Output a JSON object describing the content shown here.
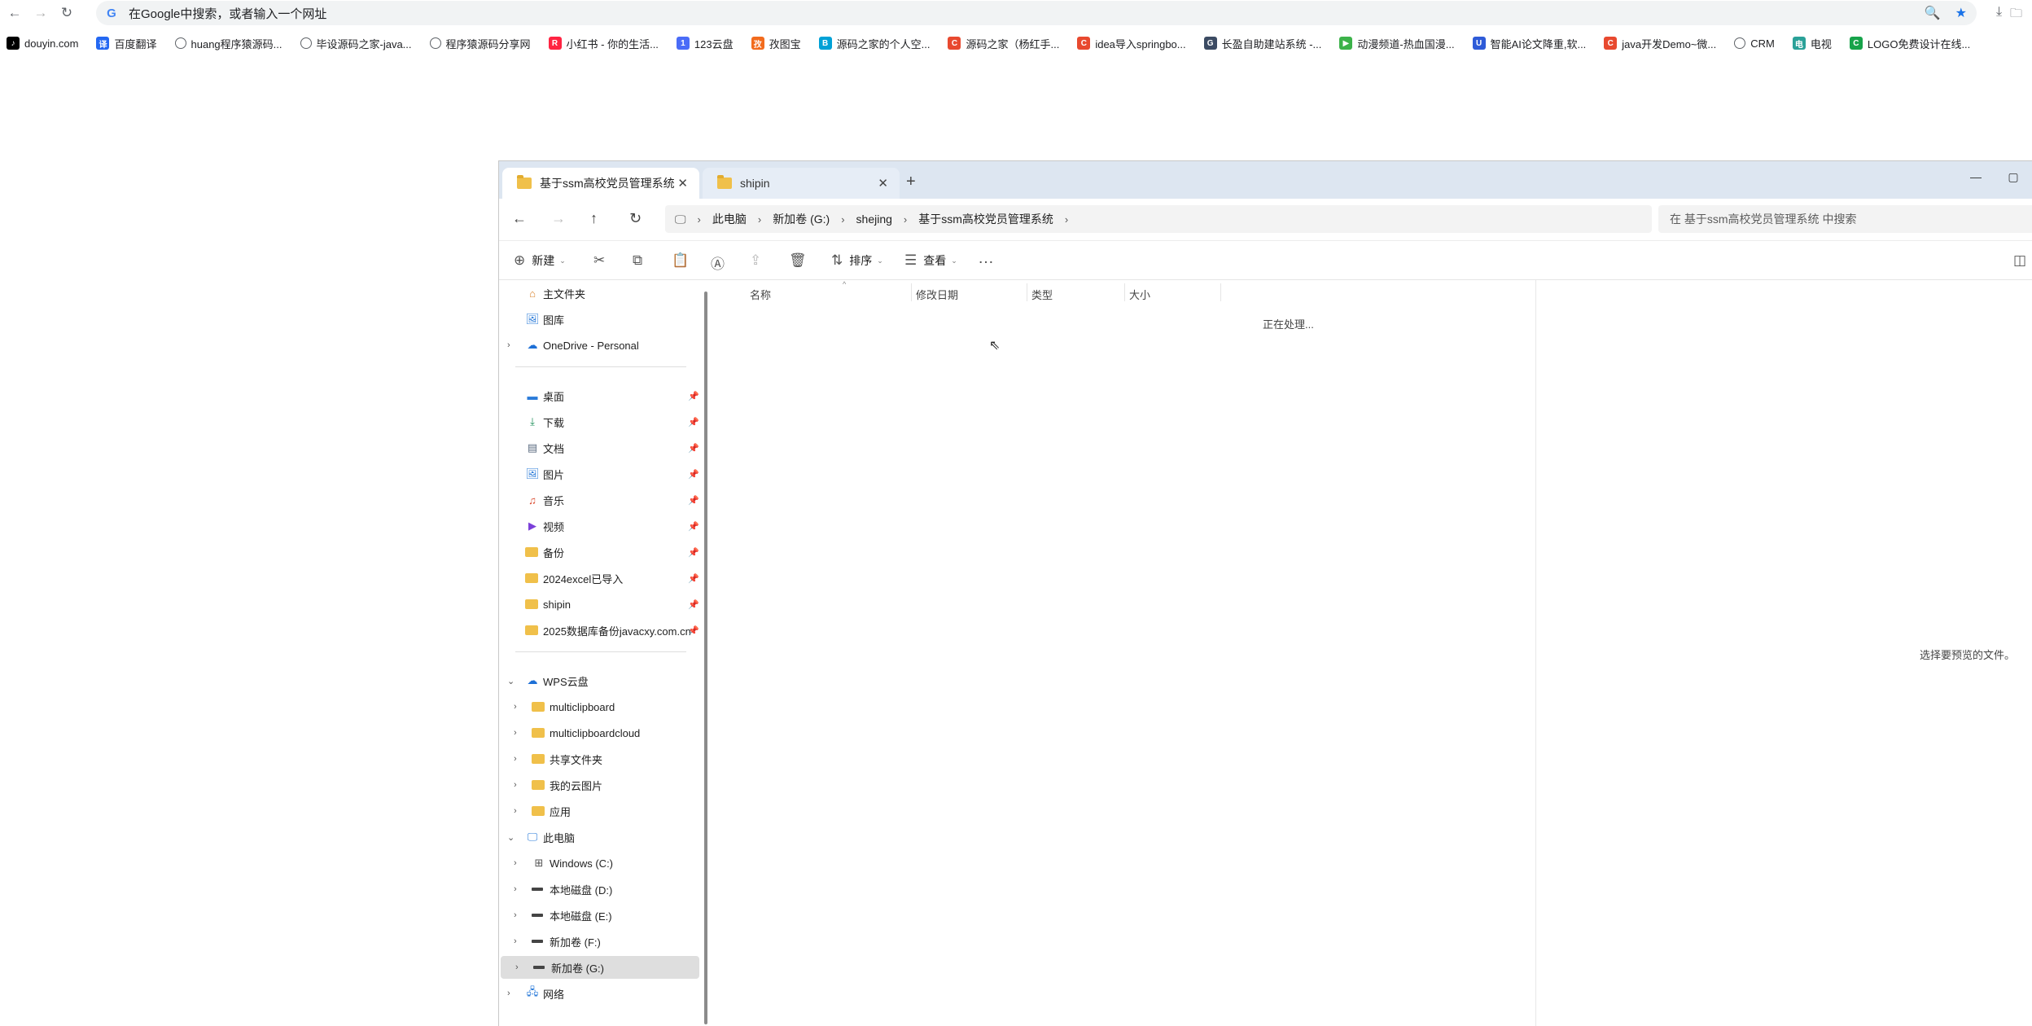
{
  "browser": {
    "omnibox_text": "在Google中搜索，或者输入一个网址"
  },
  "bookmarks": [
    {
      "label": "douyin.com",
      "color": "#000000",
      "glyph": "♪"
    },
    {
      "label": "百度翻译",
      "color": "#2468f2",
      "glyph": "译"
    },
    {
      "label": "huang程序猿源码...",
      "color": "",
      "glyph": ""
    },
    {
      "label": "毕设源码之家-java...",
      "color": "",
      "glyph": ""
    },
    {
      "label": "程序猿源码分享网",
      "color": "",
      "glyph": ""
    },
    {
      "label": "小红书 - 你的生活...",
      "color": "#ff2442",
      "glyph": "R"
    },
    {
      "label": "123云盘",
      "color": "#4a6cf7",
      "glyph": "1"
    },
    {
      "label": "孜图宝",
      "color": "#f26b1d",
      "glyph": "孜"
    },
    {
      "label": "源码之家的个人空...",
      "color": "#00a1d6",
      "glyph": "B"
    },
    {
      "label": "源码之家（杨红手...",
      "color": "#e8492f",
      "glyph": "C"
    },
    {
      "label": "idea导入springbo...",
      "color": "#e8492f",
      "glyph": "C"
    },
    {
      "label": "长盈自助建站系统 -...",
      "color": "#3c4b63",
      "glyph": "G"
    },
    {
      "label": "动漫频道-热血国漫...",
      "color": "#3cb24a",
      "glyph": "▶"
    },
    {
      "label": "智能AI论文降重,软...",
      "color": "#2e5bd8",
      "glyph": "U"
    },
    {
      "label": "java开发Demo~微...",
      "color": "#e8492f",
      "glyph": "C"
    },
    {
      "label": "CRM",
      "color": "",
      "glyph": ""
    },
    {
      "label": "电视",
      "color": "#2aa198",
      "glyph": "电"
    },
    {
      "label": "LOGO免费设计在线...",
      "color": "#17a34a",
      "glyph": "C"
    }
  ],
  "explorer": {
    "tabs": [
      {
        "label": "基于ssm高校党员管理系统"
      },
      {
        "label": "shipin"
      }
    ],
    "breadcrumb": [
      "此电脑",
      "新加卷 (G:)",
      "shejing",
      "基于ssm高校党员管理系统"
    ],
    "search_placeholder": "在 基于ssm高校党员管理系统 中搜索",
    "commands": {
      "new": "新建",
      "sort": "排序",
      "view": "查看"
    },
    "nav": {
      "home": "主文件夹",
      "gallery": "图库",
      "onedrive": "OneDrive - Personal",
      "quick": [
        {
          "label": "桌面",
          "icon": "desktop-icon"
        },
        {
          "label": "下载",
          "icon": "download-icon"
        },
        {
          "label": "文档",
          "icon": "document-icon"
        },
        {
          "label": "图片",
          "icon": "pictures-icon"
        },
        {
          "label": "音乐",
          "icon": "music-icon"
        },
        {
          "label": "视频",
          "icon": "video-icon"
        },
        {
          "label": "备份",
          "icon": "folder-icon"
        },
        {
          "label": "2024excel已导入",
          "icon": "folder-icon"
        },
        {
          "label": "shipin",
          "icon": "folder-icon"
        },
        {
          "label": "2025数据库备份javacxy.com.cn",
          "icon": "folder-icon"
        }
      ],
      "wps": "WPS云盘",
      "wps_children": [
        "multiclipboard",
        "multiclipboardcloud",
        "共享文件夹",
        "我的云图片",
        "应用"
      ],
      "this_pc": "此电脑",
      "drives": [
        "Windows (C:)",
        "本地磁盘 (D:)",
        "本地磁盘 (E:)",
        "新加卷 (F:)",
        "新加卷 (G:)"
      ],
      "network": "网络"
    },
    "columns": [
      "名称",
      "修改日期",
      "类型",
      "大小"
    ],
    "status": "正在处理...",
    "preview_text": "选择要预览的文件。"
  }
}
